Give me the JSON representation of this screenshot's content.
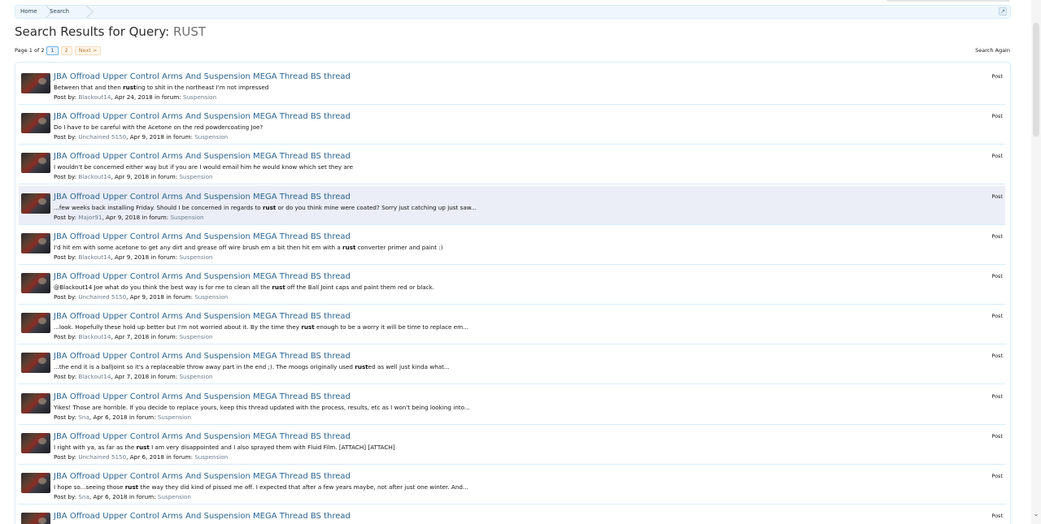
{
  "breadcrumb": {
    "home": "Home",
    "search": "Search",
    "jump_icon": "jump-to-icon"
  },
  "page": {
    "title_prefix": "Search Results for Query:",
    "query": "RUST"
  },
  "pagination": {
    "label": "Page 1 of 2",
    "current": "1",
    "page2": "2",
    "next": "Next >"
  },
  "search_again": "Search Again",
  "results": [
    {
      "title": "JBA Offroad Upper Control Arms And Suspension MEGA Thread BS thread",
      "snippet_before": "Between that and then ",
      "snippet_bold": "rust",
      "snippet_after": "ing to shit in the northeast I'm not impressed",
      "user": "Blackout14",
      "date": "Apr 24, 2018",
      "forum": "Suspension",
      "type": "Post"
    },
    {
      "title": "JBA Offroad Upper Control Arms And Suspension MEGA Thread BS thread",
      "snippet_before": "Do I have to be careful with the Acetone on the red powdercoating Joe?",
      "snippet_bold": "",
      "snippet_after": "",
      "user": "Unchained 5150",
      "date": "Apr 9, 2018",
      "forum": "Suspension",
      "type": "Post"
    },
    {
      "title": "JBA Offroad Upper Control Arms And Suspension MEGA Thread BS thread",
      "snippet_before": "I wouldn't be concerned either way but if you are I would email him he would know which set they are",
      "snippet_bold": "",
      "snippet_after": "",
      "user": "Blackout14",
      "date": "Apr 9, 2018",
      "forum": "Suspension",
      "type": "Post"
    },
    {
      "title": "JBA Offroad Upper Control Arms And Suspension MEGA Thread BS thread",
      "snippet_before": "...few weeks back installing Friday. Should I be concerned in regards to ",
      "snippet_bold": "rust",
      "snippet_after": " or do you think mine were coated? Sorry just catching up just saw...",
      "user": "Major91",
      "date": "Apr 9, 2018",
      "forum": "Suspension",
      "type": "Post"
    },
    {
      "title": "JBA Offroad Upper Control Arms And Suspension MEGA Thread BS thread",
      "snippet_before": "I'd hit em with some acetone to get any dirt and grease off wire brush em a bit then hit em with a ",
      "snippet_bold": "rust",
      "snippet_after": " converter primer and paint :)",
      "user": "Blackout14",
      "date": "Apr 9, 2018",
      "forum": "Suspension",
      "type": "Post"
    },
    {
      "title": "JBA Offroad Upper Control Arms And Suspension MEGA Thread BS thread",
      "snippet_before": "@Blackout14 Joe what do you think the best way is for me to clean all the ",
      "snippet_bold": "rust",
      "snippet_after": " off the Ball Joint caps and paint them red or black.",
      "user": "Unchained 5150",
      "date": "Apr 9, 2018",
      "forum": "Suspension",
      "type": "Post"
    },
    {
      "title": "JBA Offroad Upper Control Arms And Suspension MEGA Thread BS thread",
      "snippet_before": "...look. Hopefully these hold up better but I'm not worried about it. By the time they ",
      "snippet_bold": "rust",
      "snippet_after": " enough to be a worry it will be time to replace em...",
      "user": "Blackout14",
      "date": "Apr 7, 2018",
      "forum": "Suspension",
      "type": "Post"
    },
    {
      "title": "JBA Offroad Upper Control Arms And Suspension MEGA Thread BS thread",
      "snippet_before": "...the end it is a balljoint so it's a replaceable throw away part in the end ;). The moogs originally used ",
      "snippet_bold": "rust",
      "snippet_after": "ed as well just kinda what...",
      "user": "Blackout14",
      "date": "Apr 7, 2018",
      "forum": "Suspension",
      "type": "Post"
    },
    {
      "title": "JBA Offroad Upper Control Arms And Suspension MEGA Thread BS thread",
      "snippet_before": "Yikes! Those are horrible. If you decide to replace yours, keep this thread updated with the process, results, etc as I won't being looking into...",
      "snippet_bold": "",
      "snippet_after": "",
      "user": "Sna",
      "date": "Apr 6, 2018",
      "forum": "Suspension",
      "type": "Post"
    },
    {
      "title": "JBA Offroad Upper Control Arms And Suspension MEGA Thread BS thread",
      "snippet_before": "I right with ya, as far as the ",
      "snippet_bold": "rust",
      "snippet_after": " I am very disappointed and I also sprayed them with Fluid Film. [ATTACH] [ATTACH]",
      "user": "Unchained 5150",
      "date": "Apr 6, 2018",
      "forum": "Suspension",
      "type": "Post"
    },
    {
      "title": "JBA Offroad Upper Control Arms And Suspension MEGA Thread BS thread",
      "snippet_before": "I hope so...seeing those ",
      "snippet_bold": "rust",
      "snippet_after": " the way they did kind of pissed me off. I expected that after a few years maybe, not after just one winter. And...",
      "user": "Sna",
      "date": "Apr 6, 2018",
      "forum": "Suspension",
      "type": "Post"
    },
    {
      "title": "JBA Offroad Upper Control Arms And Suspension MEGA Thread BS thread",
      "snippet_before": "",
      "snippet_bold": "",
      "snippet_after": "",
      "user": "",
      "date": "",
      "forum": "",
      "type": "Post"
    }
  ],
  "labels": {
    "post_by": "Post by: ",
    "in_forum": " in forum: "
  },
  "scrollbar": {
    "down_icon": "chevron-down-icon"
  }
}
